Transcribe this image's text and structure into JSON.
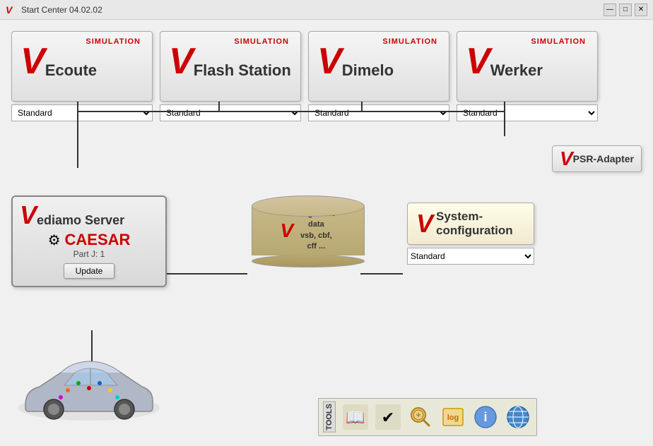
{
  "titlebar": {
    "title": "Start Center 04.02.02",
    "icon": "V",
    "controls": [
      "minimize",
      "maximize",
      "close"
    ]
  },
  "simulation_boxes": [
    {
      "id": "ecoute",
      "sim_label": "SIMULATION",
      "v": "V",
      "name": "Ecoute"
    },
    {
      "id": "flash_station",
      "sim_label": "SIMULATION",
      "v": "V",
      "name": "Flash Station"
    },
    {
      "id": "dimelo",
      "sim_label": "SIMULATION",
      "v": "V",
      "name": "Dimelo"
    },
    {
      "id": "werker",
      "sim_label": "SIMULATION",
      "v": "V",
      "name": "Werker"
    }
  ],
  "dropdowns": {
    "ecoute": "Standard",
    "flash_station": "Standard",
    "dimelo": "Standard",
    "werker": "Standard",
    "sysconfig": "Standard"
  },
  "psr_adapter": {
    "v": "V",
    "name": "PSR-Adapter"
  },
  "vediamo_server": {
    "v": "V",
    "name": "ediamo Server",
    "caesar": "CAESAR",
    "part": "Part J: 1",
    "update_btn": "Update"
  },
  "diagnostic": {
    "v": "V",
    "line1": "diagnostic data",
    "line2": "vsb, cbf, cff ..."
  },
  "sysconfig": {
    "v": "V",
    "name": "System-\nconfiguration",
    "name_line1": "System-",
    "name_line2": "configuration"
  },
  "tools": {
    "label": "TOOLS",
    "items": [
      {
        "id": "help",
        "icon": "📖",
        "name": "help-book-icon"
      },
      {
        "id": "check",
        "icon": "✅",
        "name": "check-icon"
      },
      {
        "id": "search",
        "icon": "🔍",
        "name": "search-icon"
      },
      {
        "id": "log",
        "icon": "📋",
        "name": "log-icon"
      },
      {
        "id": "info",
        "icon": "ℹ️",
        "name": "info-icon"
      },
      {
        "id": "web",
        "icon": "🌐",
        "name": "web-icon"
      }
    ]
  }
}
